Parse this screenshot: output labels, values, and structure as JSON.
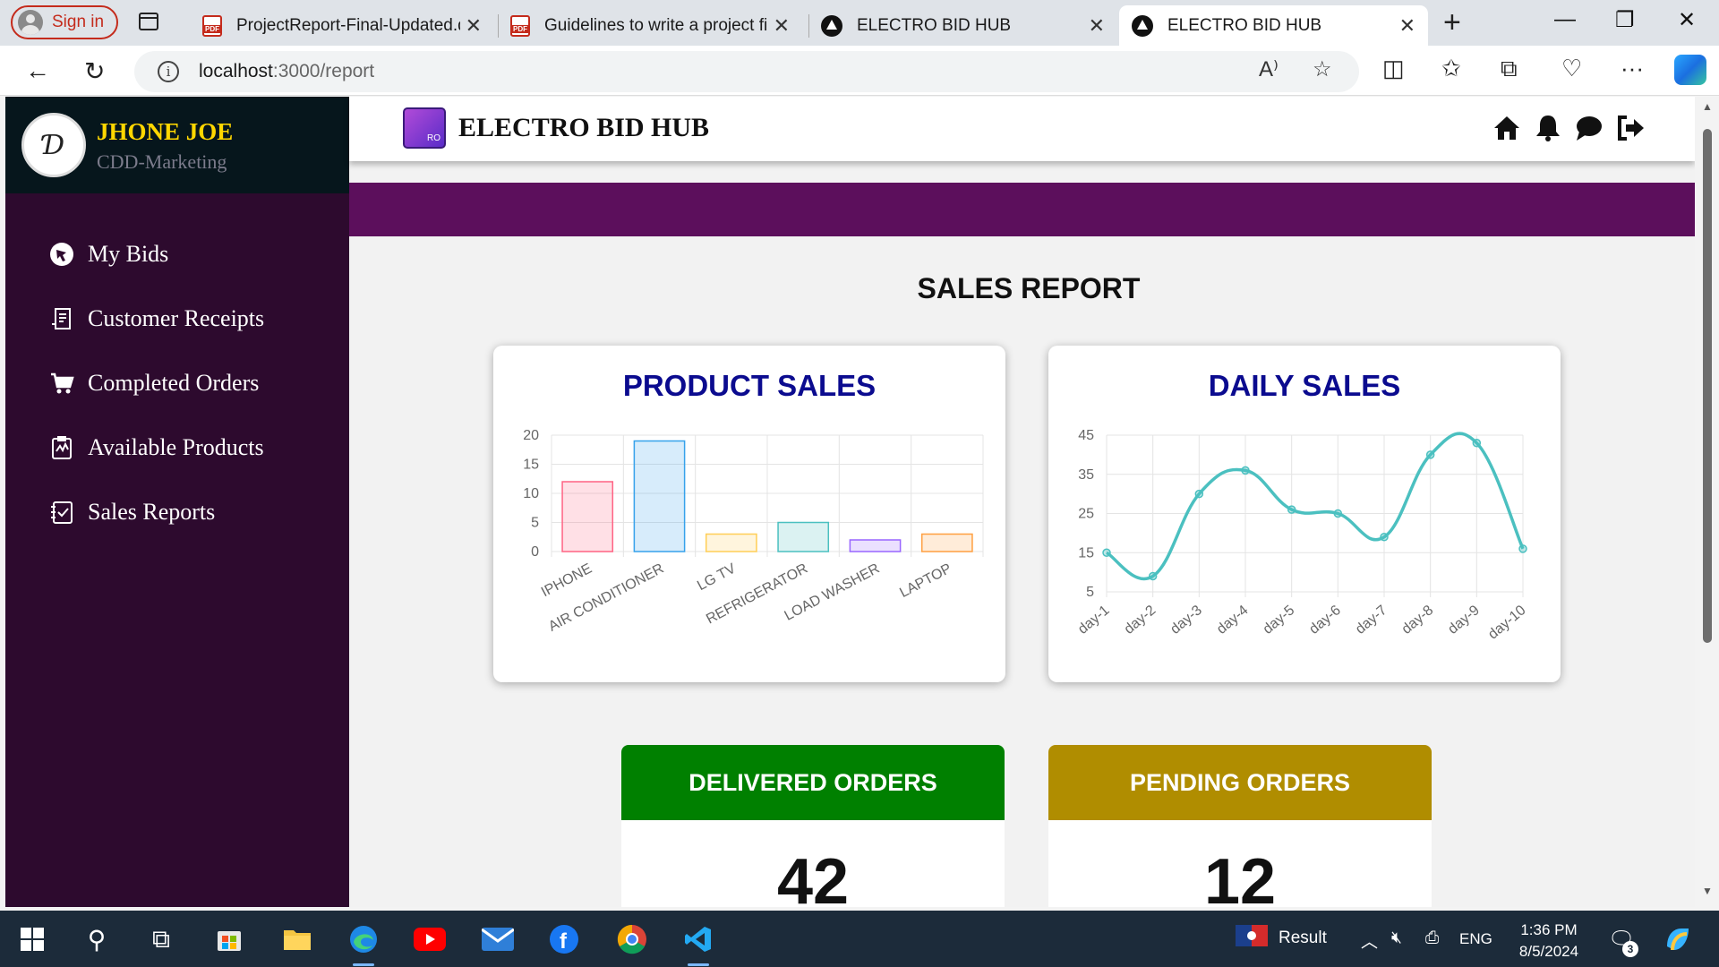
{
  "browser": {
    "signin_label": "Sign in",
    "tabs": [
      {
        "title": "ProjectReport-Final-Updated.docx",
        "icon": "pdf-icon"
      },
      {
        "title": "Guidelines to write a project final report",
        "icon": "pdf-icon"
      },
      {
        "title": "ELECTRO BID HUB",
        "icon": "app-icon"
      },
      {
        "title": "ELECTRO BID HUB",
        "icon": "app-icon",
        "active": true
      }
    ],
    "url_host": "localhost",
    "url_path": ":3000/report"
  },
  "profile": {
    "name": "JHONE JOE",
    "role": "CDD-Marketing",
    "avatar_glyph": "Ɗ"
  },
  "sidebar": {
    "items": [
      {
        "label": "My Bids",
        "icon": "bid-icon"
      },
      {
        "label": "Customer Receipts",
        "icon": "receipt-icon"
      },
      {
        "label": "Completed Orders",
        "icon": "cart-icon"
      },
      {
        "label": "Available Products",
        "icon": "product-icon"
      },
      {
        "label": "Sales Reports",
        "icon": "report-icon"
      }
    ]
  },
  "header": {
    "brand": "ELECTRO BID HUB",
    "logo_text": "RO"
  },
  "report": {
    "title": "SALES REPORT",
    "product_card_title": "PRODUCT SALES",
    "daily_card_title": "DAILY SALES",
    "delivered_label": "DELIVERED ORDERS",
    "delivered_value": "42",
    "pending_label": "PENDING ORDERS",
    "pending_value": "12"
  },
  "colors": {
    "delivered": "#008000",
    "pending": "#b08d00",
    "sidebar": "#2d0a2e",
    "banner": "#5c0f5c",
    "title": "#0b0b8f"
  },
  "taskbar": {
    "weather_label": "Result",
    "lang": "ENG",
    "time": "1:36 PM",
    "date": "8/5/2024",
    "notif_count": "3"
  },
  "chart_data": [
    {
      "type": "bar",
      "title": "PRODUCT SALES",
      "categories": [
        "IPHONE",
        "AIR CONDITIONER",
        "LG TV",
        "REFRIGERATOR",
        "LOAD WASHER",
        "LAPTOP"
      ],
      "values": [
        12,
        19,
        3,
        5,
        2,
        3
      ],
      "colors": [
        "#ff6384",
        "#36a2eb",
        "#ffce56",
        "#4bc0c0",
        "#9966ff",
        "#ff9f40"
      ],
      "ylim": [
        0,
        20
      ],
      "yticks": [
        0,
        5,
        10,
        15,
        20
      ],
      "grid": true
    },
    {
      "type": "line",
      "title": "DAILY SALES",
      "categories": [
        "day-1",
        "day-2",
        "day-3",
        "day-4",
        "day-5",
        "day-6",
        "day-7",
        "day-8",
        "day-9",
        "day-10"
      ],
      "values": [
        15,
        9,
        30,
        36,
        26,
        25,
        19,
        40,
        43,
        16
      ],
      "color": "#4bc0c0",
      "ylim": [
        5,
        45
      ],
      "yticks": [
        5,
        15,
        25,
        35,
        45
      ],
      "grid": true
    }
  ]
}
